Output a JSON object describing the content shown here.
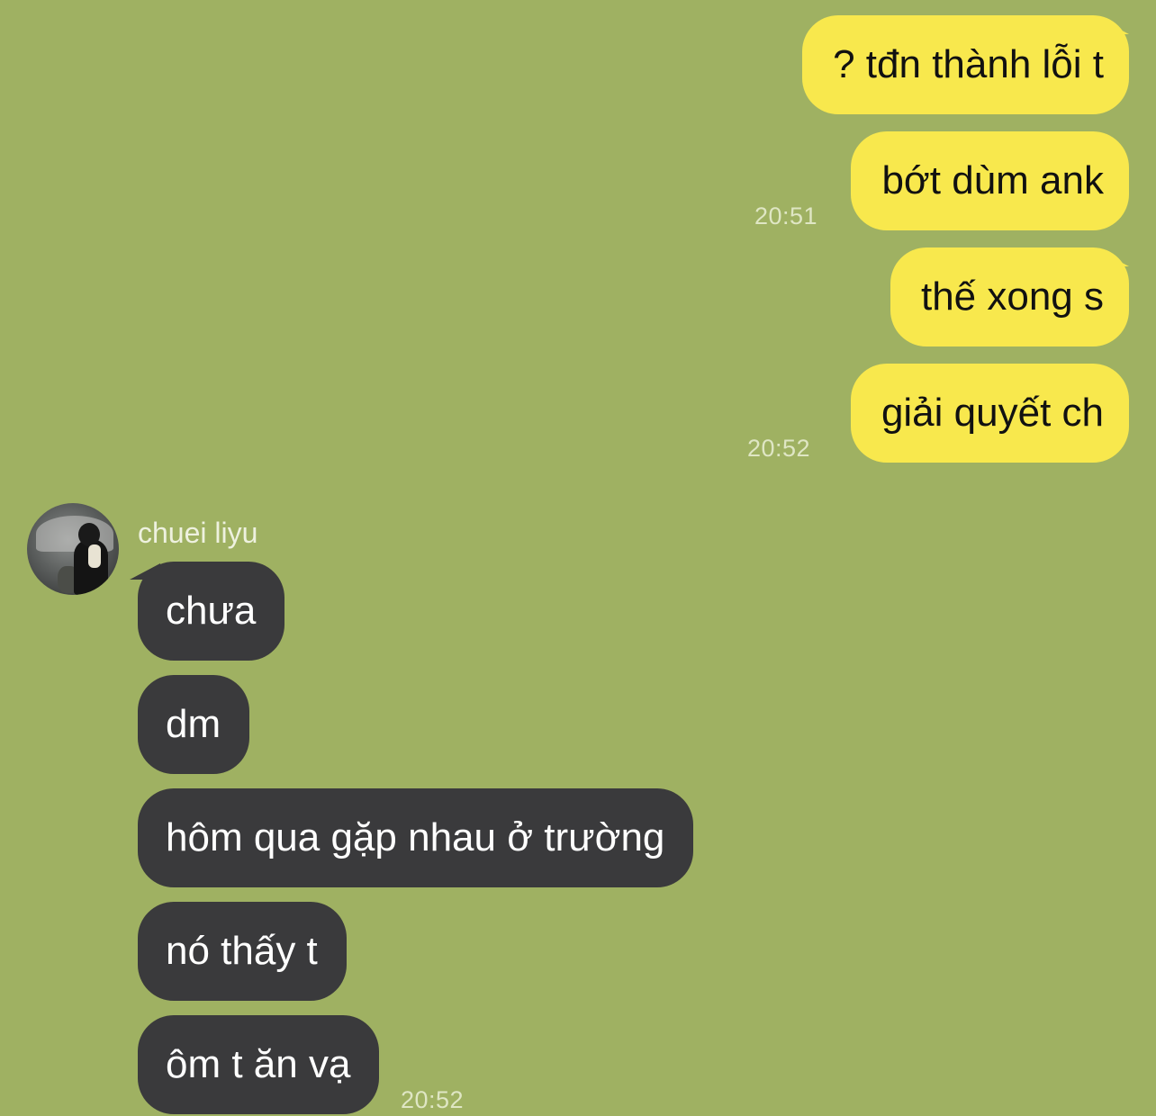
{
  "theme": {
    "background": "#9fb162",
    "outgoing_bubble": "#f8e84d",
    "incoming_bubble": "#3a3a3c",
    "timestamp_color": "#dfe6c4"
  },
  "outgoing": [
    {
      "text": "? tđn thành lỗi t"
    },
    {
      "text": "bớt dùm ank",
      "time": "20:51"
    },
    {
      "text": "thế xong s"
    },
    {
      "text": "giải quyết ch",
      "time": "20:52"
    }
  ],
  "incoming": {
    "sender": "chuei liyu",
    "avatar_icon": "profile-photo-icon",
    "messages": [
      {
        "text": "chưa"
      },
      {
        "text": "dm"
      },
      {
        "text": "hôm qua gặp nhau ở trường"
      },
      {
        "text": "nó thấy t"
      },
      {
        "text": "ôm t ăn vạ",
        "time": "20:52"
      }
    ]
  }
}
